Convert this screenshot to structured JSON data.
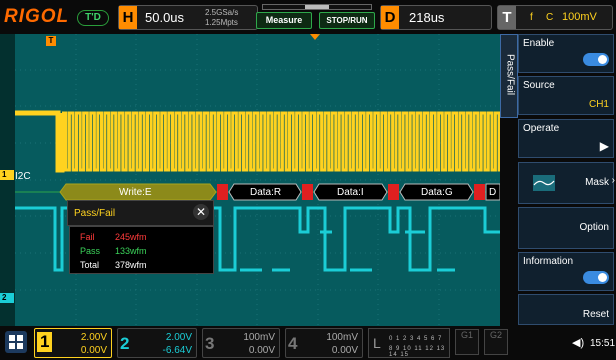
{
  "brand": {
    "logo": "RIGOL",
    "mode_badge": "T'D"
  },
  "horizontal": {
    "letter": "H",
    "timebase": "50.0us",
    "sample_rate": "2.5GSa/s",
    "memory_depth": "1.25Mpts"
  },
  "buttons": {
    "measure": "Measure",
    "stop_run": "STOP/RUN"
  },
  "delay": {
    "letter": "D",
    "value": "218us"
  },
  "trigger": {
    "letter": "T",
    "mode": "f",
    "source": "C",
    "level": "100mV"
  },
  "waveform": {
    "trigger_marker": "T",
    "decode_label": "I2C",
    "ch1_marker": "1",
    "ch2_marker": "2",
    "bus_packets": [
      "Write:E",
      "Data:R",
      "Data:I",
      "Data:G",
      "D"
    ]
  },
  "passfail": {
    "title": "Pass/Fail",
    "close": "✕",
    "rows": [
      {
        "label": "Fail",
        "value": "245wfm",
        "color": "#ff3b3b"
      },
      {
        "label": "Pass",
        "value": "133wfm",
        "color": "#3bd35a"
      },
      {
        "label": "Total",
        "value": "378wfm",
        "color": "#ffffff"
      }
    ]
  },
  "menu": {
    "tab": "Pass/Fail",
    "items": [
      {
        "label": "Enable",
        "value": ""
      },
      {
        "label": "Source",
        "value": "CH1"
      },
      {
        "label": "Operate",
        "value": "▶"
      },
      {
        "label": "",
        "value": "Mask"
      },
      {
        "label": "",
        "value": "Option"
      },
      {
        "label": "Information",
        "value": ""
      },
      {
        "label": "",
        "value": "Reset"
      }
    ]
  },
  "channels": [
    {
      "num": "1",
      "volts": "2.00V",
      "offset": "0.00V",
      "color": "#ffd21f"
    },
    {
      "num": "2",
      "volts": "2.00V",
      "offset": "-6.64V",
      "color": "#1bcdd6"
    },
    {
      "num": "3",
      "volts": "100mV",
      "offset": "0.00V",
      "color": "#777777"
    },
    {
      "num": "4",
      "volts": "100mV",
      "offset": "0.00V",
      "color": "#777777"
    }
  ],
  "logic": {
    "letter": "L",
    "row1": "0 1 2 3  4 5 6 7",
    "row2": "8 9 10 11 12 13 14 15"
  },
  "gen": [
    "G1",
    "G2"
  ],
  "status": {
    "time": "15:51",
    "speaker": "◀)"
  }
}
